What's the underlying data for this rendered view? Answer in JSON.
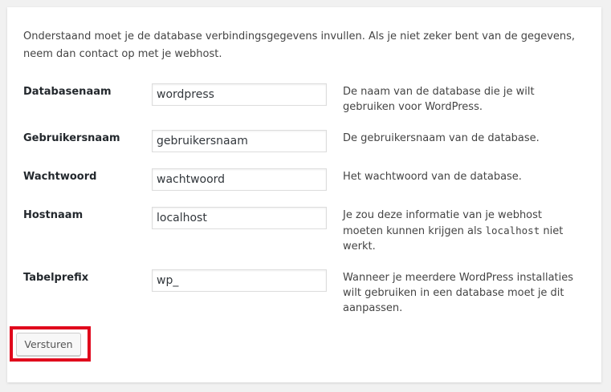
{
  "intro": {
    "text": "Onderstaand moet je de database verbindingsgegevens invullen. Als je niet zeker bent van de gegevens, neem dan contact op met je webhost."
  },
  "form": {
    "rows": [
      {
        "label": "Databasenaam",
        "value": "wordpress",
        "help": "De naam van de database die je wilt gebruiken voor WordPress."
      },
      {
        "label": "Gebruikersnaam",
        "value": "gebruikersnaam",
        "help": "De gebruikersnaam van de database."
      },
      {
        "label": "Wachtwoord",
        "value": "wachtwoord",
        "help": "Het wachtwoord van de database."
      },
      {
        "label": "Hostnaam",
        "value": "localhost",
        "help_before": "Je zou deze informatie van je webhost moeten kunnen krijgen als ",
        "help_code": "localhost",
        "help_after": " niet werkt."
      },
      {
        "label": "Tabelprefix",
        "value": "wp_",
        "help": "Wanneer je meerdere WordPress installaties wilt gebruiken in een database moet je dit aanpassen."
      }
    ],
    "submit_label": "Versturen"
  },
  "colors": {
    "highlight": "#e0061c",
    "background": "#f1f1f1",
    "panel": "#ffffff"
  }
}
